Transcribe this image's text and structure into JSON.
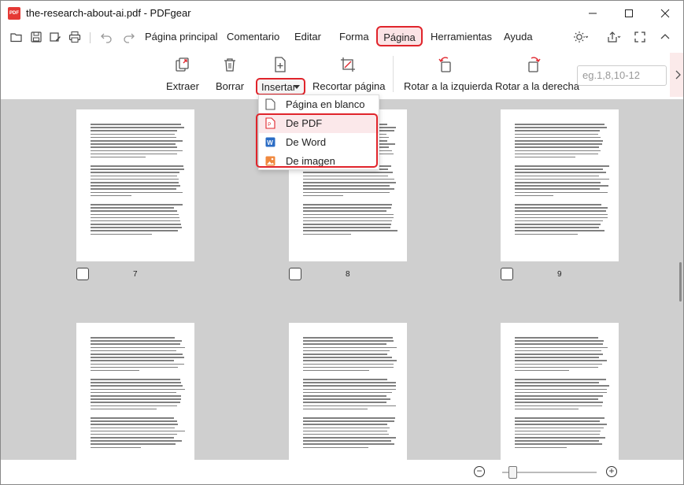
{
  "window": {
    "title": "the-research-about-ai.pdf - PDFgear",
    "logo_text": "PDF",
    "controls": [
      "minimize-icon",
      "maximize-icon",
      "close-icon"
    ]
  },
  "menubar": {
    "items": [
      {
        "label": "Página principal"
      },
      {
        "label": "Comentario"
      },
      {
        "label": "Editar"
      },
      {
        "label": "Forma"
      },
      {
        "label": "Página",
        "active": true
      },
      {
        "label": "Herramientas"
      },
      {
        "label": "Ayuda"
      }
    ],
    "quick_icons": [
      "open-folder-icon",
      "save-icon",
      "save-as-icon",
      "print-icon",
      "undo-icon",
      "redo-icon"
    ],
    "right_icons": [
      "theme-icon",
      "share-icon",
      "fullscreen-icon",
      "collapse-icon"
    ]
  },
  "toolbar": {
    "extract": "Extraer",
    "delete": "Borrar",
    "insert": "Insertar",
    "crop": "Recortar página",
    "rotate_left": "Rotar a la izquierda",
    "rotate_right": "Rotar a la derecha",
    "range_placeholder": "eg.1,8,10-12"
  },
  "insert_menu": {
    "items": [
      {
        "label": "Página en blanco",
        "icon": "blank-page-icon"
      },
      {
        "label": "De PDF",
        "icon": "pdf-file-icon"
      },
      {
        "label": "De Word",
        "icon": "word-file-icon"
      },
      {
        "label": "De imagen",
        "icon": "image-file-icon"
      }
    ]
  },
  "pages": [
    {
      "number": "7"
    },
    {
      "number": "8"
    },
    {
      "number": "9"
    },
    {
      "number": ""
    },
    {
      "number": ""
    },
    {
      "number": ""
    }
  ],
  "colors": {
    "accent_red": "#e0242b",
    "highlight_pink": "#fbe3e5",
    "content_bg": "#cfcfcf",
    "word_blue": "#2b6cc4",
    "image_orange": "#f0883e"
  }
}
